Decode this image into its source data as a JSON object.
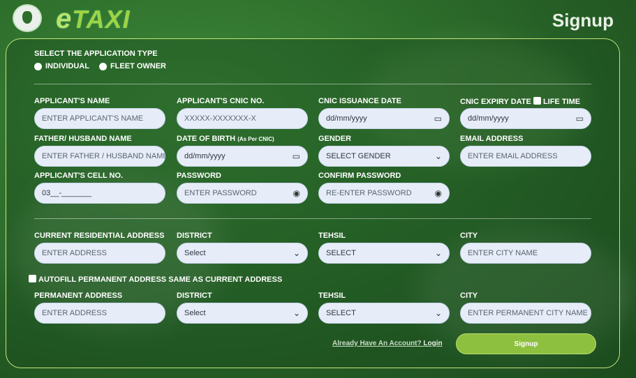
{
  "header": {
    "logo_text_e": "e",
    "logo_text_rest": "TAXI",
    "title": "Signup"
  },
  "application_type": {
    "label": "SELECT THE APPLICATION TYPE",
    "options": [
      "INDIVIDUAL",
      "FLEET OWNER"
    ]
  },
  "personal": {
    "name_label": "APPLICANT'S NAME",
    "name_placeholder": "ENTER APPLICANT'S NAME",
    "cnic_label": "APPLICANT'S CNIC NO.",
    "cnic_placeholder": "XXXXX-XXXXXXX-X",
    "issue_label": "CNIC ISSUANCE DATE",
    "issue_value": "dd/mm/yyyy",
    "expiry_label": "CNIC EXPIRY DATE",
    "lifetime_label": "LIFE TIME",
    "expiry_value": "dd/mm/yyyy",
    "father_label": "FATHER/ HUSBAND NAME",
    "father_placeholder": "ENTER FATHER / HUSBAND NAME",
    "dob_label": "DATE OF BIRTH",
    "dob_note": "(As Per CNIC)",
    "dob_value": "dd/mm/yyyy",
    "gender_label": "GENDER",
    "gender_value": "SELECT GENDER",
    "email_label": "EMAIL ADDRESS",
    "email_placeholder": "ENTER EMAIL ADDRESS",
    "cell_label": "APPLICANT'S CELL NO.",
    "cell_value": "03__-_______",
    "password_label": "PASSWORD",
    "password_placeholder": "ENTER PASSWORD",
    "confirm_label": "CONFIRM PASSWORD",
    "confirm_placeholder": "RE-ENTER PASSWORD"
  },
  "current_address": {
    "address_label": "CURRENT RESIDENTIAL ADDRESS",
    "address_placeholder": "ENTER ADDRESS",
    "district_label": "DISTRICT",
    "district_value": "Select",
    "tehsil_label": "TEHSIL",
    "tehsil_value": "SELECT",
    "city_label": "CITY",
    "city_placeholder": "ENTER CITY NAME"
  },
  "autofill_label": "AUTOFILL PERMANENT ADDRESS SAME AS CURRENT ADDRESS",
  "permanent_address": {
    "address_label": "PERMANENT ADDRESS",
    "address_placeholder": "ENTER ADDRESS",
    "district_label": "DISTRICT",
    "district_value": "Select",
    "tehsil_label": "TEHSIL",
    "tehsil_value": "SELECT",
    "city_label": "CITY",
    "city_placeholder": "ENTER PERMANENT CITY NAME"
  },
  "footer": {
    "already_text": "Already Have An Account?",
    "login_text": "Login",
    "signup_button": "Signup"
  }
}
